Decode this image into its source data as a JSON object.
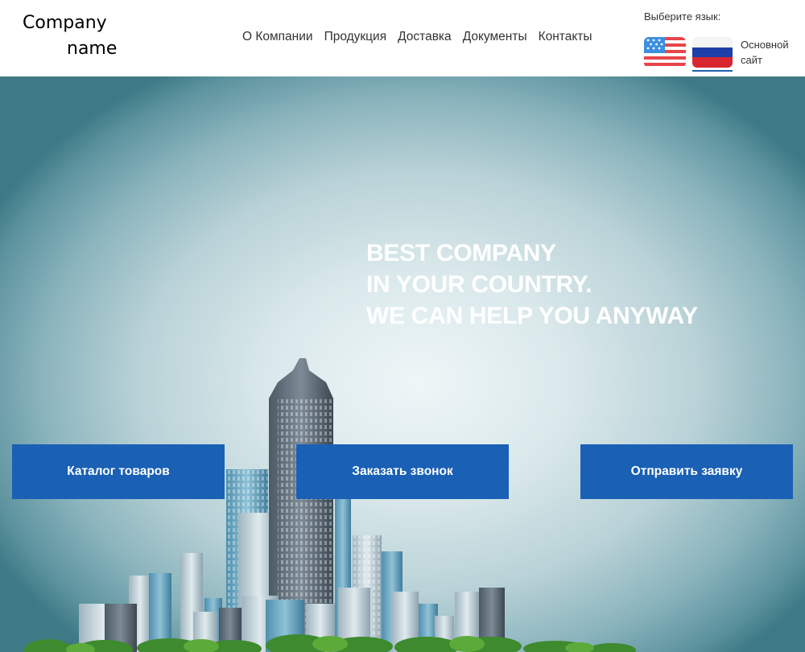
{
  "brand": {
    "line1": "Company",
    "line2": "name"
  },
  "nav": {
    "items": [
      {
        "label": "О Компании"
      },
      {
        "label": "Продукция"
      },
      {
        "label": "Доставка"
      },
      {
        "label": "Документы"
      },
      {
        "label": "Контакты"
      }
    ]
  },
  "language": {
    "label": "Выберите язык:",
    "options": [
      {
        "icon": "us-flag-icon"
      },
      {
        "icon": "russia-flag-icon"
      }
    ],
    "main_site": "Основной сайт"
  },
  "hero": {
    "headline": [
      "BEST COMPANY",
      "IN YOUR COUNTRY.",
      "WE CAN HELP YOU ANYWAY"
    ],
    "buttons": [
      {
        "label": "Каталог товаров"
      },
      {
        "label": "Заказать звонок"
      },
      {
        "label": "Отправить заявку"
      }
    ]
  },
  "colors": {
    "accent": "#1a60b5",
    "headline": "#ffffff",
    "nav_text": "#333333"
  }
}
